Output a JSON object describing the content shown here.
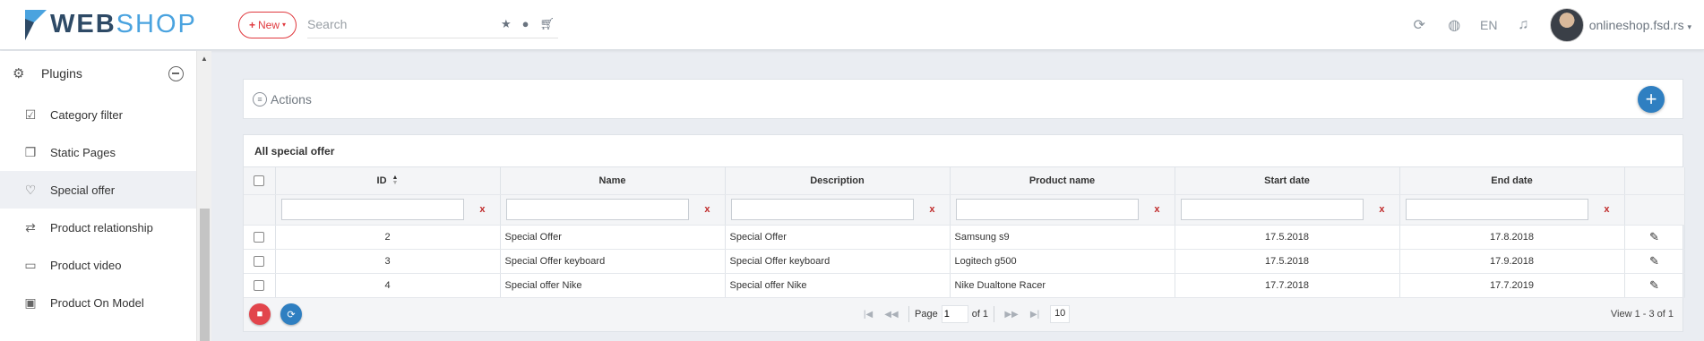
{
  "header": {
    "logo_web": "WEB",
    "logo_shop": "SHOP",
    "new_label": "New",
    "search_placeholder": "Search",
    "lang": "EN",
    "account": "onlineshop.fsd.rs"
  },
  "sidebar": {
    "group_label": "Plugins",
    "items": [
      {
        "label": "Category filter",
        "icon": "checkbox-icon"
      },
      {
        "label": "Static Pages",
        "icon": "bookmark-icon"
      },
      {
        "label": "Special offer",
        "icon": "heart-icon"
      },
      {
        "label": "Product relationship",
        "icon": "shuffle-icon"
      },
      {
        "label": "Product video",
        "icon": "video-icon"
      },
      {
        "label": "Product On Model",
        "icon": "image-icon"
      }
    ]
  },
  "actions": {
    "label": "Actions"
  },
  "grid": {
    "caption": "All special offer",
    "columns": [
      "ID",
      "Name",
      "Description",
      "Product name",
      "Start date",
      "End date"
    ],
    "filter_clear": "x",
    "rows": [
      {
        "id": "2",
        "name": "Special Offer",
        "description": "Special Offer",
        "product": "Samsung s9",
        "start": "17.5.2018",
        "end": "17.8.2018"
      },
      {
        "id": "3",
        "name": "Special Offer keyboard",
        "description": "Special Offer keyboard",
        "product": "Logitech g500",
        "start": "17.5.2018",
        "end": "17.9.2018"
      },
      {
        "id": "4",
        "name": "Special offer Nike",
        "description": "Special offer Nike",
        "product": " Nike Dualtone Racer",
        "start": "17.7.2018",
        "end": "17.7.2019"
      }
    ]
  },
  "pager": {
    "page_label": "Page",
    "page_value": "1",
    "of_label": "of 1",
    "page_size": "10",
    "view_text": "View 1 - 3 of 1"
  },
  "colors": {
    "accent": "#2f7fc1",
    "danger": "#e2454c",
    "brand_dark": "#2e4a66",
    "brand_light": "#4aa3df"
  }
}
